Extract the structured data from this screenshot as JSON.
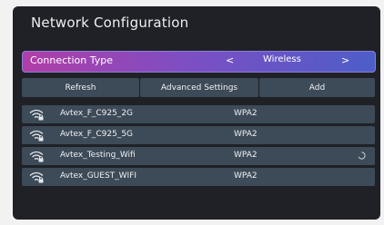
{
  "title": "Network Configuration",
  "connection": {
    "label": "Connection Type",
    "prev_glyph": "<",
    "value": "Wireless",
    "next_glyph": ">"
  },
  "buttons": {
    "refresh": "Refresh",
    "advanced": "Advanced Settings",
    "add": "Add"
  },
  "networks": [
    {
      "ssid": "Avtex_F_C925_2G",
      "security": "WPA2",
      "icon": "wifi-locked-icon"
    },
    {
      "ssid": "Avtex_F_C925_5G",
      "security": "WPA2",
      "icon": "wifi-locked-icon"
    },
    {
      "ssid": "Avtex_Testing_Wifi",
      "security": "WPA2",
      "icon": "wifi-locked-icon",
      "status_icon": "loading-spinner-icon"
    },
    {
      "ssid": "Avtex_GUEST_WIFI",
      "security": "WPA2",
      "icon": "wifi-locked-icon"
    }
  ],
  "colors": {
    "screen_bg": "#1f2126",
    "button_bg": "#3d4a57",
    "selected_gradient": [
      "#b13ea7",
      "#4d5ec9"
    ]
  }
}
